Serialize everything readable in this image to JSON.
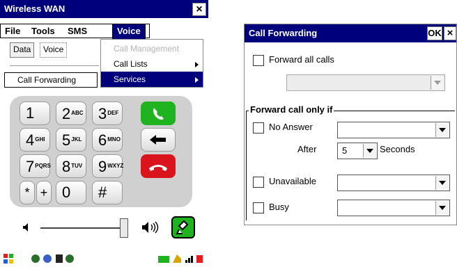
{
  "left_window": {
    "title": "Wireless WAN",
    "close_glyph": "×",
    "menu": [
      "File",
      "Tools",
      "SMS",
      "Voice"
    ],
    "tabs": [
      "Data",
      "Voice"
    ],
    "submenu_selected": "Call Forwarding",
    "voice_menu": [
      {
        "label": "Call Management",
        "disabled": true
      },
      {
        "label": "Call Lists",
        "has_submenu": true
      },
      {
        "label": "Services",
        "highlighted": true,
        "has_submenu": true
      }
    ],
    "keys": [
      {
        "main": "1",
        "sub": ""
      },
      {
        "main": "2",
        "sub": "ABC"
      },
      {
        "main": "3",
        "sub": "DEF"
      },
      {
        "main": "4",
        "sub": "GHI"
      },
      {
        "main": "5",
        "sub": "JKL"
      },
      {
        "main": "6",
        "sub": "MNO"
      },
      {
        "main": "7",
        "sub": "PQRS"
      },
      {
        "main": "8",
        "sub": "TUV"
      },
      {
        "main": "9",
        "sub": "WXYZ"
      },
      {
        "main": "*",
        "sub": ""
      },
      {
        "main": "+",
        "sub": ""
      },
      {
        "main": "0",
        "sub": ""
      },
      {
        "main": "#",
        "sub": ""
      }
    ],
    "colors": {
      "title_bar": "#00007c",
      "call_key": "#1fb31f",
      "end_key": "#d9141c",
      "mic_key": "#1fb31f"
    },
    "icons": [
      "speaker-low-icon",
      "speaker-high-icon",
      "microphone-icon",
      "start-icon",
      "network-icon",
      "signal-icon",
      "battery-icon"
    ]
  },
  "dialog": {
    "title": "Call Forwarding",
    "ok_label": "OK",
    "close_glyph": "×",
    "forward_all_label": "Forward all calls",
    "section_label": "Forward call only if",
    "no_answer_label": "No Answer",
    "after_label": "After",
    "after_value": "5",
    "seconds_label": "Seconds",
    "unavailable_label": "Unavailable",
    "busy_label": "Busy"
  }
}
